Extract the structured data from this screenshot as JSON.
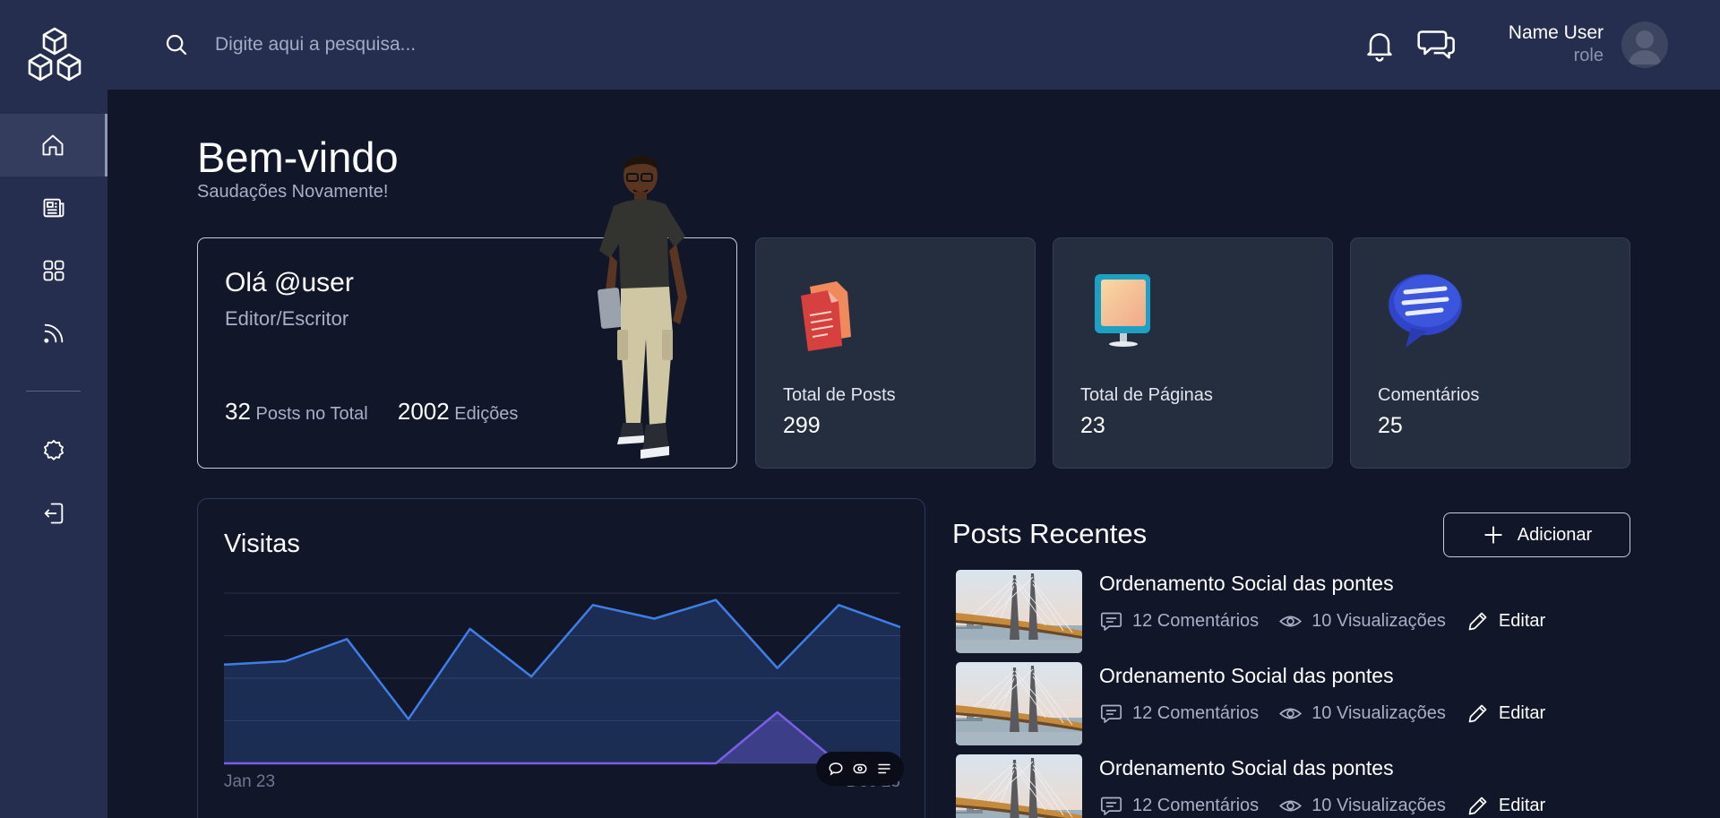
{
  "topbar": {
    "search_placeholder": "Digite aqui a pesquisa...",
    "user_name": "Name User",
    "user_role": "role"
  },
  "sidebar": {
    "items": [
      {
        "icon": "home-icon",
        "active": true
      },
      {
        "icon": "newspaper-icon",
        "active": false
      },
      {
        "icon": "grid-icon",
        "active": false
      },
      {
        "icon": "rss-icon",
        "active": false
      },
      {
        "icon": "settings-icon",
        "active": false
      },
      {
        "icon": "logout-icon",
        "active": false
      }
    ]
  },
  "welcome": {
    "title": "Bem-vindo",
    "subtitle": "Saudações Novamente!"
  },
  "profile": {
    "hello": "Olá @user",
    "role": "Editor/Escritor",
    "posts_count": "32",
    "posts_label": "Posts no Total",
    "edits_count": "2002",
    "edits_label": "Edições"
  },
  "stats": [
    {
      "label": "Total de Posts",
      "value": "299",
      "icon": "documents-icon"
    },
    {
      "label": "Total de Páginas",
      "value": "23",
      "icon": "monitor-icon"
    },
    {
      "label": "Comentários",
      "value": "25",
      "icon": "speech-bubble-icon"
    }
  ],
  "visits": {
    "title": "Visitas",
    "chart_data": {
      "type": "area",
      "x_start_label": "Jan 23",
      "x_end_label": "Dec 23",
      "ylim": [
        0,
        100
      ],
      "grid": true,
      "series": [
        {
          "values": [
            58,
            60,
            73,
            26,
            79,
            51,
            93,
            85,
            96,
            56,
            93,
            80
          ],
          "color": "#3f7ee8"
        },
        {
          "values": [
            0,
            0,
            0,
            0,
            0,
            0,
            0,
            0,
            0,
            30,
            0,
            0
          ],
          "color": "#7a5ee8"
        }
      ]
    }
  },
  "recent_posts": {
    "title": "Posts Recentes",
    "add_label": "Adicionar",
    "items": [
      {
        "title": "Ordenamento Social das pontes",
        "comments": "12 Comentários",
        "views": "10 Visualizações",
        "edit": "Editar"
      },
      {
        "title": "Ordenamento Social das pontes",
        "comments": "12 Comentários",
        "views": "10 Visualizações",
        "edit": "Editar"
      },
      {
        "title": "Ordenamento Social das pontes",
        "comments": "12 Comentários",
        "views": "10 Visualizações",
        "edit": "Editar"
      }
    ]
  }
}
